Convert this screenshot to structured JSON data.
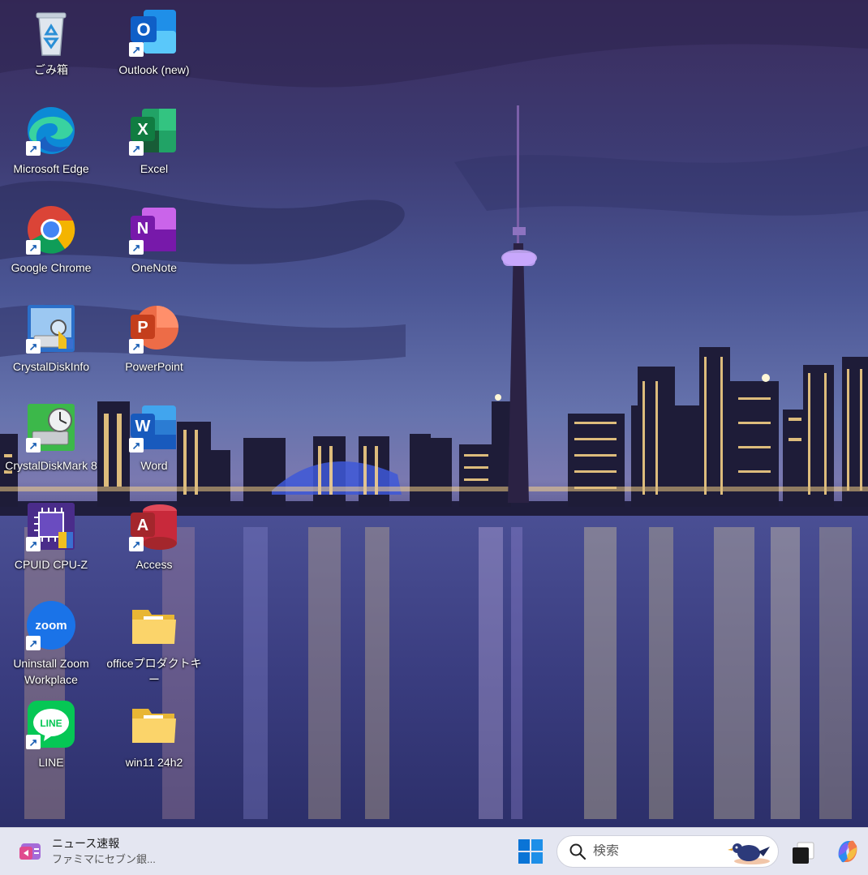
{
  "desktop": {
    "icons": [
      {
        "label": "ごみ箱",
        "icon": "recycle-bin-icon"
      },
      {
        "label": "Outlook (new)",
        "icon": "outlook-icon"
      },
      {
        "label": "Microsoft Edge",
        "icon": "edge-icon"
      },
      {
        "label": "Excel",
        "icon": "excel-icon"
      },
      {
        "label": "Google Chrome",
        "icon": "chrome-icon"
      },
      {
        "label": "OneNote",
        "icon": "onenote-icon"
      },
      {
        "label": "CrystalDiskInfo",
        "icon": "crystaldiskinfo-icon"
      },
      {
        "label": "PowerPoint",
        "icon": "powerpoint-icon"
      },
      {
        "label": "CrystalDiskMark 8",
        "icon": "crystaldiskmark-icon"
      },
      {
        "label": "Word",
        "icon": "word-icon"
      },
      {
        "label": "CPUID CPU-Z",
        "icon": "cpuz-icon"
      },
      {
        "label": "Access",
        "icon": "access-icon"
      },
      {
        "label": "Uninstall Zoom Workplace",
        "icon": "zoom-icon"
      },
      {
        "label": "officeプロダクトキー",
        "icon": "folder-icon"
      },
      {
        "label": "LINE",
        "icon": "line-icon"
      },
      {
        "label": "win11 24h2",
        "icon": "folder-icon"
      }
    ],
    "icon_glyphs": {
      "outlook": "O",
      "excel": "X",
      "onenote": "N",
      "powerpoint": "P",
      "word": "W",
      "access": "A",
      "zoom": "zoom",
      "line": "LINE"
    }
  },
  "taskbar": {
    "news_title": "ニュース速報",
    "news_subtitle": "ファミマにセブン銀...",
    "search_placeholder": "検索",
    "colors": {
      "background": "#e4e6f1",
      "start_blue": "#0a74d6"
    }
  }
}
